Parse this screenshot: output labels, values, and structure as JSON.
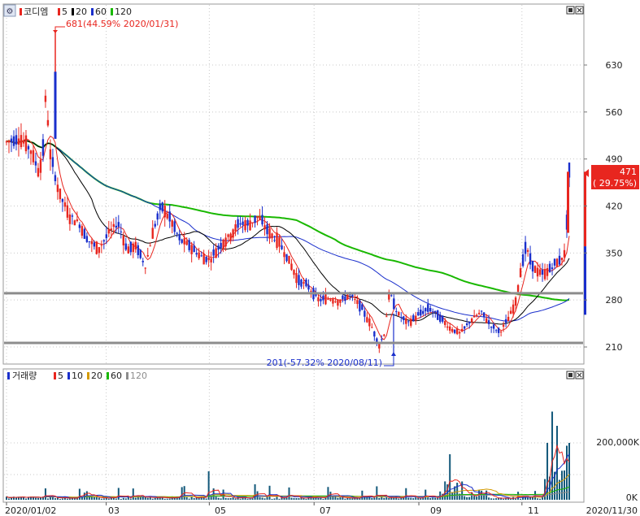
{
  "window_buttons": [
    "▣",
    "✕"
  ],
  "price_panel": {
    "legend": [
      {
        "label": "코디엠",
        "color": "#e8261f"
      },
      {
        "label": "5",
        "color": "#e8261f"
      },
      {
        "label": "20",
        "color": "#000000"
      },
      {
        "label": "60",
        "color": "#1a2fcc"
      },
      {
        "label": "120",
        "color": "#19b800"
      }
    ],
    "high_annotation": "681(44.59% 2020/01/31)",
    "low_annotation": "201(-57.32% 2020/08/11)",
    "current_price": "471",
    "current_change": "( 29.75%)",
    "yticks": [
      "630",
      "560",
      "490",
      "420",
      "350",
      "280",
      "210"
    ],
    "support_lines": [
      290,
      216
    ]
  },
  "volume_panel": {
    "legend": [
      {
        "label": "거래량",
        "color": "#1a2fcc"
      },
      {
        "label": "5",
        "color": "#e8261f"
      },
      {
        "label": "10",
        "color": "#1a2fcc"
      },
      {
        "label": "20",
        "color": "#d49a00"
      },
      {
        "label": "60",
        "color": "#19b800"
      },
      {
        "label": "120",
        "color": "#8c8c8c"
      }
    ],
    "yticks": [
      "200,000K",
      "0K"
    ]
  },
  "xaxis": {
    "labels": [
      "2020/01/02",
      "03",
      "05",
      "07",
      "09",
      "11"
    ],
    "end_label": "2020/11/30"
  },
  "chart_data": [
    {
      "type": "line",
      "subtype": "candlestick",
      "title": "코디엠",
      "x_range": [
        "2020/01/02",
        "2020/11/30"
      ],
      "ylim": [
        190,
        680
      ],
      "grid": true,
      "key_points": [
        {
          "date": "2020/01/02",
          "close": 515
        },
        {
          "date": "2020/01/31",
          "high": 681
        },
        {
          "date": "2020/02/20",
          "close": 400
        },
        {
          "date": "2020/03/20",
          "close": 330
        },
        {
          "date": "2020/04/10",
          "close": 420
        },
        {
          "date": "2020/05/20",
          "close": 400
        },
        {
          "date": "2020/06/20",
          "close": 330
        },
        {
          "date": "2020/07/15",
          "close": 278
        },
        {
          "date": "2020/08/11",
          "low": 201
        },
        {
          "date": "2020/09/10",
          "close": 265
        },
        {
          "date": "2020/10/20",
          "close": 230
        },
        {
          "date": "2020/11/02",
          "high": 480
        },
        {
          "date": "2020/11/20",
          "close": 310
        },
        {
          "date": "2020/11/30",
          "close": 471
        }
      ],
      "moving_averages": [
        {
          "name": "120",
          "color": "#19b800",
          "values_at_points": [
            540,
            520,
            480,
            440,
            400,
            345,
            320,
            300,
            290
          ]
        },
        {
          "name": "60",
          "color": "#1a2fcc",
          "values_at_points": [
            530,
            490,
            400,
            370,
            330,
            270,
            260,
            250,
            275
          ]
        },
        {
          "name": "20",
          "color": "#000000",
          "values_at_points": [
            530,
            430,
            390,
            370,
            300,
            250,
            240,
            260,
            330
          ]
        }
      ],
      "annotations": [
        "681(44.59% 2020/01/31)",
        "201(-57.32% 2020/08/11)",
        "471 ( 29.75%)"
      ]
    },
    {
      "type": "bar",
      "title": "거래량",
      "ylim": [
        0,
        320000
      ],
      "unit": "K",
      "spikes": [
        {
          "date": "2020/01/31",
          "value": 40000
        },
        {
          "date": "2020/05/20",
          "value": 100000
        },
        {
          "date": "2020/08/13",
          "value": 160000
        },
        {
          "date": "2020/11/02",
          "value": 310000
        },
        {
          "date": "2020/11/27",
          "value": 200000
        }
      ]
    }
  ]
}
